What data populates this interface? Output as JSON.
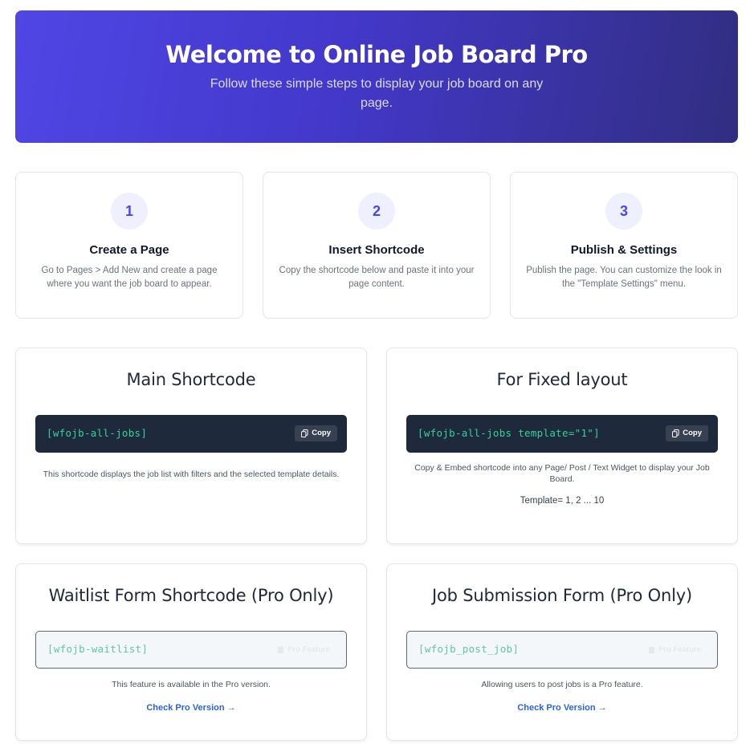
{
  "hero": {
    "title": "Welcome to Online Job Board Pro",
    "subtitle": "Follow these simple steps to display your job board on any page."
  },
  "steps": [
    {
      "number": "1",
      "title": "Create a Page",
      "text": "Go to Pages > Add New and create a page where you want the job board to appear."
    },
    {
      "number": "2",
      "title": "Insert Shortcode",
      "text": "Copy the shortcode below and paste it into your page content."
    },
    {
      "number": "3",
      "title": "Publish & Settings",
      "text": "Publish the page. You can customize the look in the \"Template Settings\" menu."
    }
  ],
  "cards": {
    "main": {
      "title": "Main Shortcode",
      "code": "[wfojb-all-jobs]",
      "copy_label": "Copy",
      "description": "This shortcode displays the job list with filters and the selected template details."
    },
    "fixed": {
      "title": "For Fixed layout",
      "code": "[wfojb-all-jobs template=\"1\"]",
      "copy_label": "Copy",
      "description": "Copy & Embed shortcode into any Page/ Post / Text Widget to display your Job Board.",
      "template_note": "Template= 1, 2 ... 10"
    },
    "waitlist": {
      "title": "Waitlist Form Shortcode (Pro Only)",
      "code": "[wfojb-waitlist]",
      "copy_label": "Pro Feature",
      "description": "This feature is available in the Pro version.",
      "link": "Check Pro Version →"
    },
    "submission": {
      "title": "Job Submission Form (Pro Only)",
      "code": "[wfojb_post_job]",
      "copy_label": "Pro Feature",
      "description": "Allowing users to post jobs is a Pro feature.",
      "link": "Check Pro Version →"
    }
  },
  "icons": {
    "copy": "copy-icon",
    "lock": "copy-icon"
  },
  "colors": {
    "accent": "#4f46e5",
    "link": "#2563eb",
    "code_green": "#34d399",
    "code_bg": "#1e293b"
  }
}
